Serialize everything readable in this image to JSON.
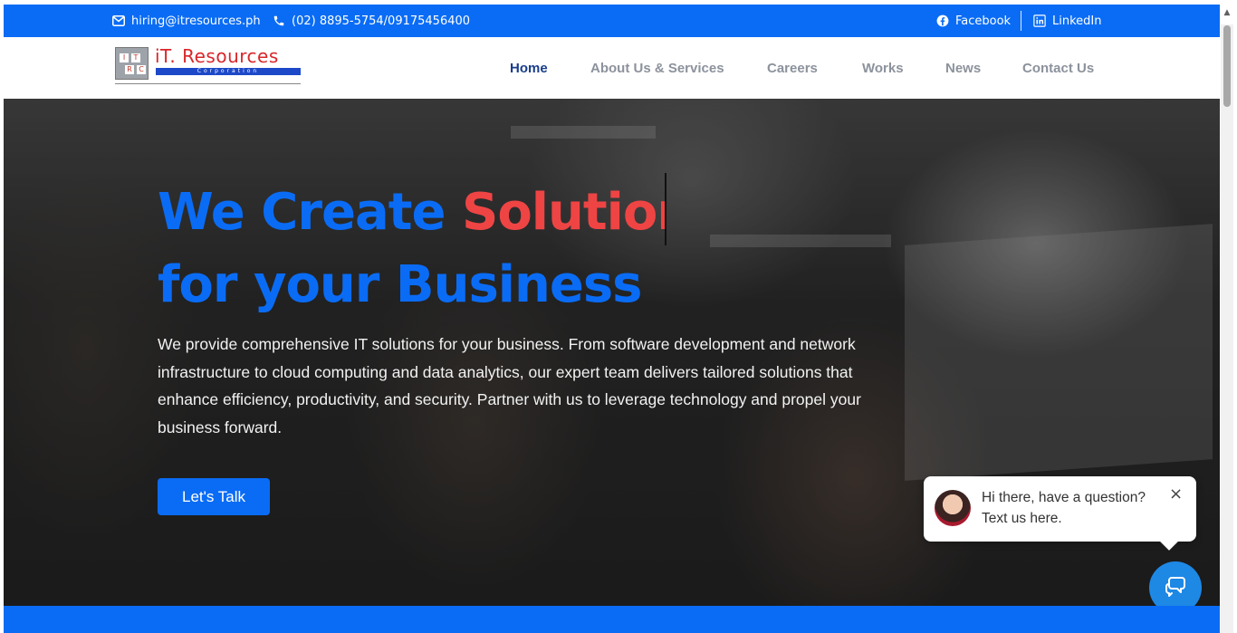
{
  "topbar": {
    "email": "hiring@itresources.ph",
    "phone": "(02) 8895-5754/09175456400",
    "facebook": "Facebook",
    "linkedin": "LinkedIn"
  },
  "logo": {
    "name_it": "iT.",
    "name_resources": "Resources",
    "corporation": "Corporation",
    "box_letters": [
      "I",
      "T",
      "R",
      "C"
    ]
  },
  "nav": {
    "items": [
      "Home",
      "About Us & Services",
      "Careers",
      "Works",
      "News",
      "Contact Us"
    ],
    "active": "Home"
  },
  "hero": {
    "title_prefix": "We Create ",
    "title_typed": "Solution",
    "title_line2": "for your Business",
    "description": "We provide comprehensive IT solutions for your business. From software development and network infrastructure to cloud computing and data analytics, our expert team delivers tailored solutions that enhance efficiency, productivity, and security. Partner with us to leverage technology and propel your business forward.",
    "cta": "Let's Talk"
  },
  "chat": {
    "line1": "Hi there, have a question?",
    "line2": "Text us here.",
    "close": "×"
  },
  "colors": {
    "brand_blue": "#0a6cf5",
    "accent_red": "#ef4444",
    "nav_active": "#1a3e8a",
    "nav_inactive": "#8c929c",
    "chat_blue": "#1e88e5"
  },
  "icons": [
    "envelope-icon",
    "phone-icon",
    "facebook-icon",
    "linkedin-icon",
    "chat-icon",
    "close-icon"
  ]
}
